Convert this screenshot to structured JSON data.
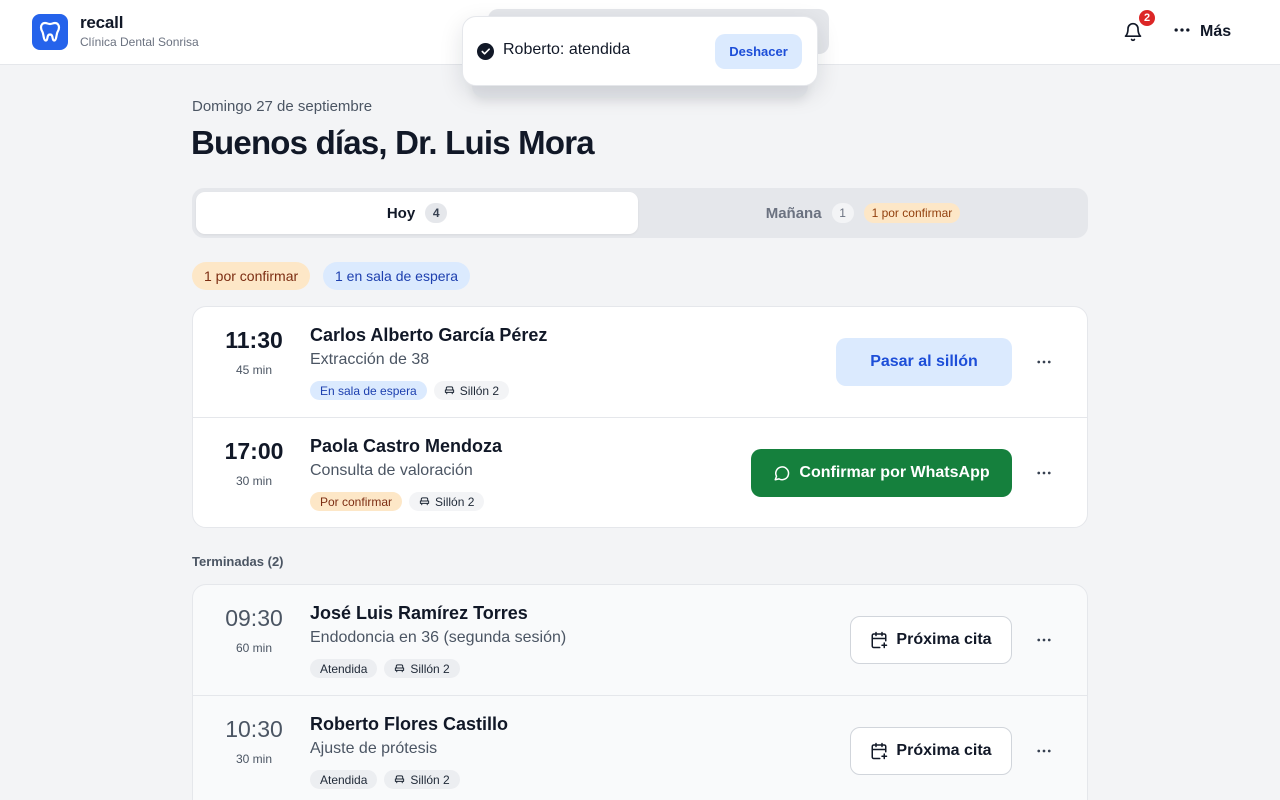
{
  "header": {
    "app_name": "recall",
    "clinic_name": "Clínica Dental Sonrisa",
    "notifications_count": "2",
    "more_label": "Más",
    "logo_icon": "tooth-icon",
    "bell_icon": "bell-icon"
  },
  "toast": {
    "message": "Roberto: atendida",
    "undo_label": "Deshacer"
  },
  "page": {
    "date": "Domingo 27 de septiembre",
    "greeting": "Buenos días, Dr. Luis Mora"
  },
  "tabs": [
    {
      "label": "Hoy",
      "count": "4",
      "selected": true
    },
    {
      "label": "Mañana",
      "count": "1",
      "badge": "1 por confirmar",
      "selected": false
    }
  ],
  "filters": [
    {
      "label": "1 por confirmar"
    },
    {
      "label": "1 en sala de espera"
    }
  ],
  "appointments_active": [
    {
      "time": "11:30",
      "duration": "45 min",
      "patient": "Carlos Alberto García Pérez",
      "procedure": "Extracción de 38",
      "status": "En sala de espera",
      "chair": "Sillón 2",
      "action": "Pasar al sillón"
    },
    {
      "time": "17:00",
      "duration": "30 min",
      "patient": "Paola Castro Mendoza",
      "procedure": "Consulta de valoración",
      "status": "Por confirmar",
      "chair": "Sillón 2",
      "action": "Confirmar por WhatsApp"
    }
  ],
  "finished": {
    "title": "Terminadas (2)",
    "items": [
      {
        "time": "09:30",
        "duration": "60 min",
        "patient": "José Luis Ramírez Torres",
        "procedure": "Endodoncia en 36 (segunda sesión)",
        "status": "Atendida",
        "chair": "Sillón 2",
        "action": "Próxima cita"
      },
      {
        "time": "10:30",
        "duration": "30 min",
        "patient": "Roberto Flores Castillo",
        "procedure": "Ajuste de prótesis",
        "status": "Atendida",
        "chair": "Sillón 2",
        "action": "Próxima cita"
      }
    ]
  },
  "colors": {
    "brand": "#2563eb",
    "whatsapp": "#15803d",
    "pending_bg": "#fde7c7",
    "waiting_bg": "#dbeafe",
    "badge_red": "#dc2626"
  }
}
